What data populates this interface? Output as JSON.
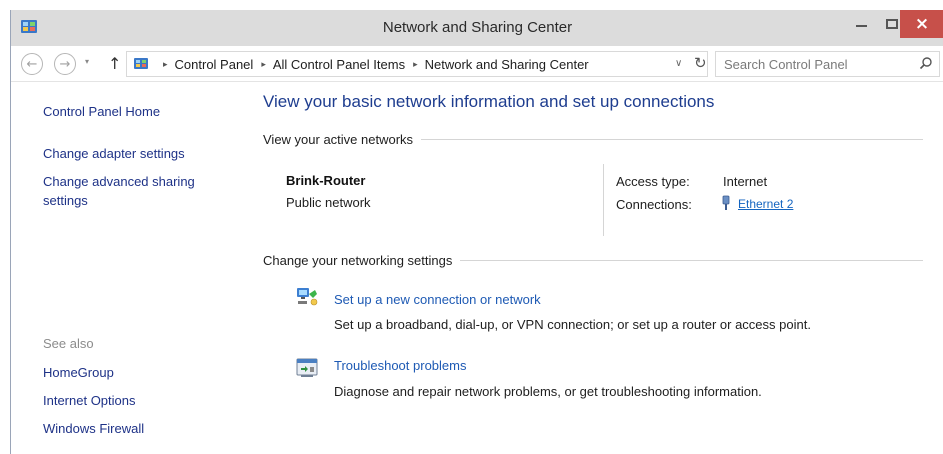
{
  "window": {
    "title": "Network and Sharing Center",
    "close_glyph": "×"
  },
  "nav": {
    "back_glyph": "←",
    "forward_glyph": "→",
    "recent_glyph": "▾",
    "up_glyph": "↑",
    "separator_glyph": "▸",
    "dropdown_glyph": "∨",
    "refresh_glyph": "↻",
    "breadcrumbs": [
      "Control Panel",
      "All Control Panel Items",
      "Network and Sharing Center"
    ]
  },
  "search": {
    "placeholder": "Search Control Panel",
    "value": ""
  },
  "sidebar": {
    "home": "Control Panel Home",
    "adapter": "Change adapter settings",
    "advanced": "Change advanced sharing settings",
    "see_also_label": "See also",
    "see_also": [
      "HomeGroup",
      "Internet Options",
      "Windows Firewall"
    ]
  },
  "main": {
    "title": "View your basic network information and set up connections",
    "active_networks_heading": "View your active networks",
    "network": {
      "name": "Brink-Router",
      "type": "Public network",
      "access_type_label": "Access type:",
      "access_type_value": "Internet",
      "connections_label": "Connections:",
      "connections_value": "Ethernet 2"
    },
    "change_heading": "Change your networking settings",
    "tasks": [
      {
        "link": "Set up a new connection or network",
        "description": "Set up a broadband, dial-up, or VPN connection; or set up a router or access point.",
        "icon": "network-setup-icon"
      },
      {
        "link": "Troubleshoot problems",
        "description": "Diagnose and repair network problems, or get troubleshooting information.",
        "icon": "troubleshoot-icon"
      }
    ]
  },
  "colors": {
    "link": "#1e3287",
    "title_blue": "#1e3d8f",
    "close_button": "#c7504a",
    "titlebar": "#dcdcdc"
  }
}
